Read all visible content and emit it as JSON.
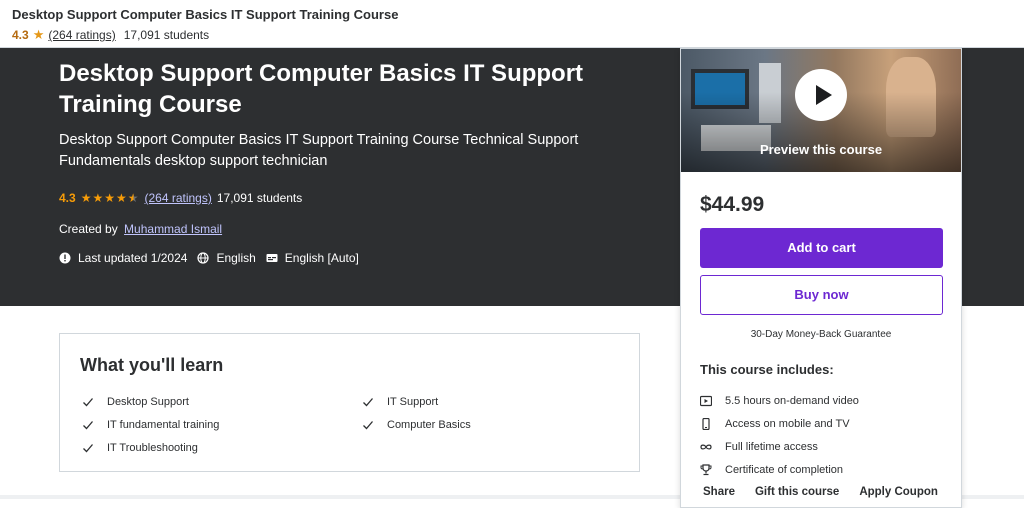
{
  "topbar": {
    "title": "Desktop Support Computer Basics IT Support Training Course",
    "rating": "4.3",
    "ratings_count": "(264 ratings)",
    "students": "17,091 students"
  },
  "hero": {
    "title": "Desktop Support Computer Basics IT Support Training Course",
    "subtitle": "Desktop Support Computer Basics IT Support Training Course Technical Support Fundamentals desktop support technician",
    "rating": "4.3",
    "ratings_count": "(264 ratings)",
    "students": "17,091 students",
    "created_by_label": "Created by",
    "author": "Muhammad Ismail",
    "last_updated": "Last updated 1/2024",
    "language": "English",
    "captions": "English [Auto]"
  },
  "card": {
    "preview_label": "Preview this course",
    "price": "$44.99",
    "add_to_cart": "Add to cart",
    "buy_now": "Buy now",
    "guarantee": "30-Day Money-Back Guarantee",
    "includes_title": "This course includes:",
    "includes": [
      {
        "icon": "video-icon",
        "label": "5.5 hours on-demand video"
      },
      {
        "icon": "mobile-icon",
        "label": "Access on mobile and TV"
      },
      {
        "icon": "infinity-icon",
        "label": "Full lifetime access"
      },
      {
        "icon": "trophy-icon",
        "label": "Certificate of completion"
      }
    ],
    "actions": {
      "share": "Share",
      "gift": "Gift this course",
      "coupon": "Apply Coupon"
    }
  },
  "learn": {
    "title": "What you'll learn",
    "items": [
      "Desktop Support",
      "IT Support",
      "IT fundamental training",
      "Computer Basics",
      "IT Troubleshooting"
    ]
  },
  "colors": {
    "accent": "#6d28d2",
    "star": "#f69c08",
    "hero_bg": "#2d2f31"
  }
}
